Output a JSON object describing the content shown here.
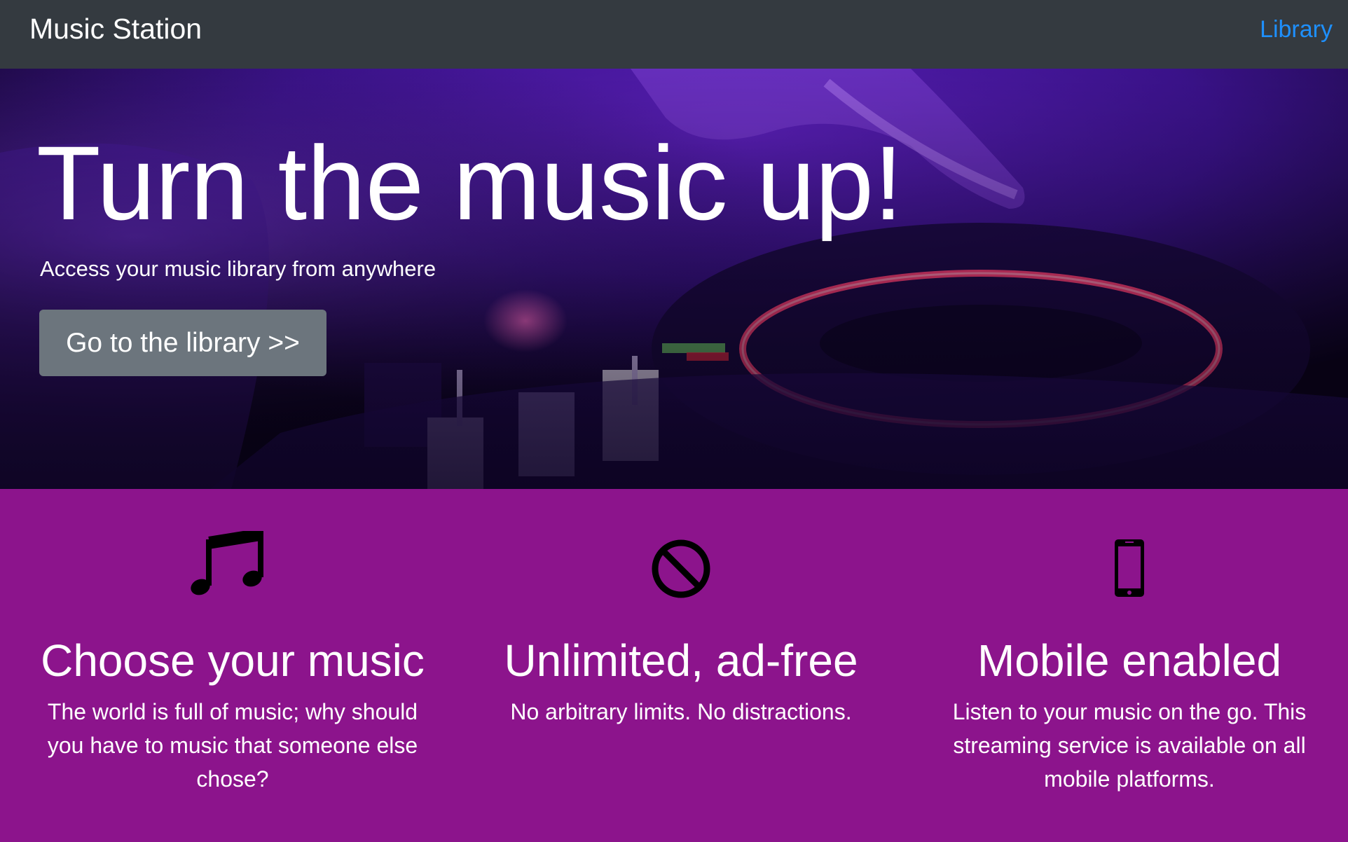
{
  "navbar": {
    "brand": "Music Station",
    "link": "Library",
    "link_color": "#1e90ff",
    "background": "#343a40"
  },
  "hero": {
    "title": "Turn the music up!",
    "subtitle": "Access your music library from anywhere",
    "button_label": "Go to the library >>",
    "button_color": "#6c757d"
  },
  "features": {
    "background": "#8c148c",
    "items": [
      {
        "icon": "music-note-icon",
        "title": "Choose your music",
        "text": "The world is full of music; why should you have to music that someone else chose?"
      },
      {
        "icon": "prohibited-icon",
        "title": "Unlimited, ad-free",
        "text": "No arbitrary limits. No distractions."
      },
      {
        "icon": "mobile-phone-icon",
        "title": "Mobile enabled",
        "text": "Listen to your music on the go. This streaming service is available on all mobile platforms."
      }
    ]
  }
}
